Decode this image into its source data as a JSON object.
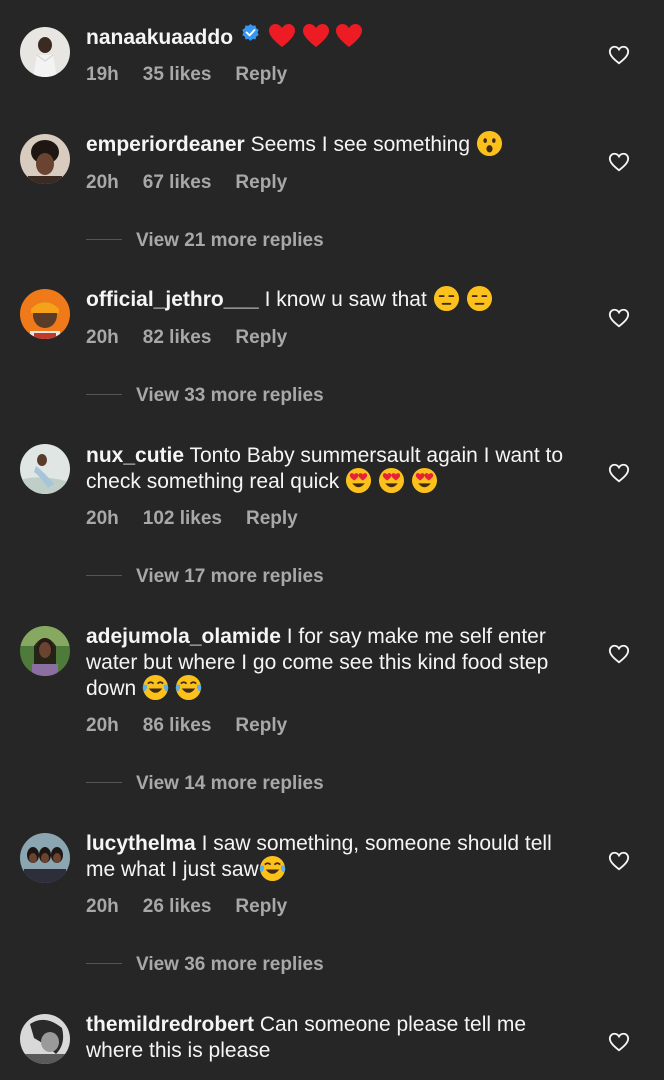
{
  "comments": [
    {
      "username": "nanaakuaaddo",
      "verified": true,
      "text": "",
      "emojis": [
        "heart",
        "heart",
        "heart"
      ],
      "time": "19h",
      "likes": "35 likes",
      "reply": "Reply",
      "view_replies": ""
    },
    {
      "username": "emperiordeaner",
      "verified": false,
      "text": "Seems I see something",
      "emojis": [
        "surprised"
      ],
      "time": "20h",
      "likes": "67 likes",
      "reply": "Reply",
      "view_replies": "View 21 more replies"
    },
    {
      "username": "official_jethro___",
      "verified": false,
      "text": "I know u saw that",
      "emojis": [
        "expressionless",
        "expressionless"
      ],
      "time": "20h",
      "likes": "82 likes",
      "reply": "Reply",
      "view_replies": "View 33 more replies"
    },
    {
      "username": "nux_cutie",
      "verified": false,
      "text": "Tonto Baby summersault again I want to check something real quick",
      "emojis": [
        "heart-eyes",
        "heart-eyes",
        "heart-eyes"
      ],
      "time": "20h",
      "likes": "102 likes",
      "reply": "Reply",
      "view_replies": "View 17 more replies"
    },
    {
      "username": "adejumola_olamide",
      "verified": false,
      "text": "I for say make me self enter water but where I go come see this kind food step down",
      "emojis": [
        "tears-of-joy",
        "tears-of-joy"
      ],
      "time": "20h",
      "likes": "86 likes",
      "reply": "Reply",
      "view_replies": "View 14 more replies"
    },
    {
      "username": "lucythelma",
      "verified": false,
      "text": "I saw something, someone should tell me  what I just saw",
      "emojis": [
        "tears-of-joy"
      ],
      "time": "20h",
      "likes": "26 likes",
      "reply": "Reply",
      "view_replies": "View 36 more replies"
    },
    {
      "username": "themildredrobert",
      "verified": false,
      "text": "Can someone please tell me where this is  please",
      "emojis": [],
      "time": "",
      "likes": "",
      "reply": "",
      "view_replies": ""
    }
  ],
  "colors": {
    "background": "#262626",
    "text": "#f5f5f5",
    "secondary": "#a8a8a8",
    "verified": "#3897f0",
    "heart": "#ed1c24"
  }
}
